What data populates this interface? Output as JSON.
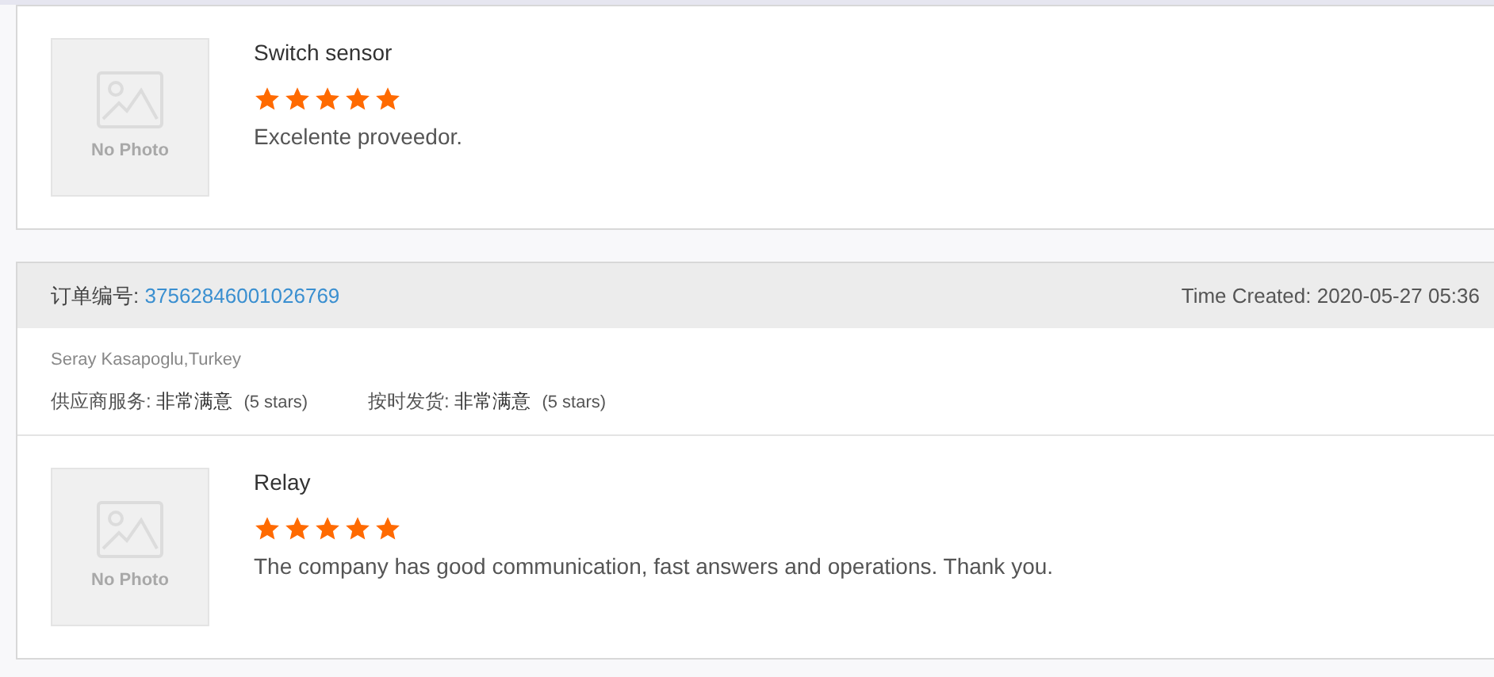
{
  "reviews": [
    {
      "product": {
        "photo_label": "No Photo",
        "name": "Switch sensor",
        "stars": 5,
        "comment": "Excelente proveedor."
      }
    },
    {
      "order": {
        "label": "订单编号:",
        "number": "37562846001026769",
        "time_created": "Time Created: 2020-05-27 05:36"
      },
      "buyer": "Seray Kasapoglu,Turkey",
      "ratings": [
        {
          "label": "供应商服务:",
          "value": "非常满意",
          "note": "(5 stars)"
        },
        {
          "label": "按时发货:",
          "value": "非常满意",
          "note": "(5 stars)"
        }
      ],
      "product": {
        "photo_label": "No Photo",
        "name": "Relay",
        "stars": 5,
        "comment": "The company has good communication, fast answers and operations. Thank you."
      }
    }
  ]
}
